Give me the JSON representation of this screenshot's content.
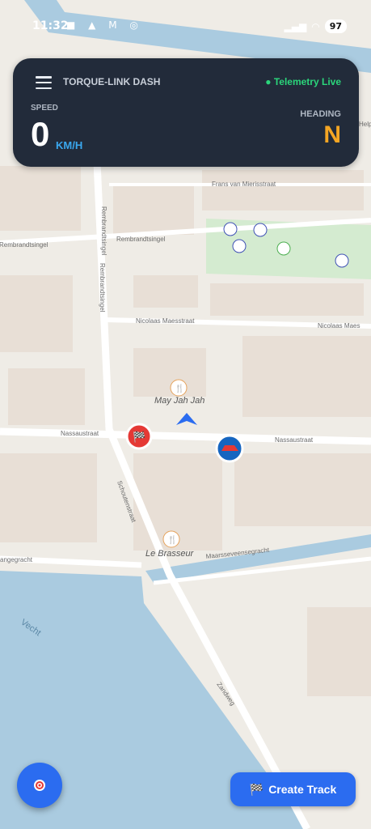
{
  "status_bar": {
    "time": "11:32",
    "battery": "97"
  },
  "dashboard": {
    "app_title": "TORQUE-LINK DASH",
    "telemetry_status": "Telemetry Live",
    "speed_label": "SPEED",
    "speed_value": "0",
    "speed_unit": "KM/H",
    "heading_label": "HEADING",
    "heading_value": "N"
  },
  "map": {
    "street_labels": [
      "Frans van Mierisstraat",
      "Rembrandtsingel",
      "Nicolaas Maesstraat",
      "Nicolaas Maes",
      "Nassaustraat",
      "Nassaustraat",
      "Schoutenstraat",
      "Maarsseveensegracht",
      "Zandweg",
      "Vecht",
      "angegracht",
      "Rembrandtsingel",
      "Rembrandtsingel",
      "Rembrandtsingel",
      "Help"
    ],
    "places": [
      {
        "name": "May Jah Jah",
        "icon": "restaurant-icon"
      },
      {
        "name": "Le Brasseur",
        "icon": "restaurant-icon"
      }
    ],
    "markers": [
      {
        "name": "checkered-flag-marker",
        "icon": "checkered-flag-icon",
        "color": "#e53935"
      },
      {
        "name": "car-marker",
        "icon": "car-icon",
        "color": "#1565c0"
      },
      {
        "name": "location-arrow",
        "icon": "navigation-arrow-icon",
        "color": "#2b6cf0"
      }
    ],
    "colors": {
      "water": "#aacbe0",
      "park": "#d4ebd0",
      "road": "#ffffff",
      "building": "#e8dfd6",
      "land": "#efece6"
    }
  },
  "fab": {
    "icon": "target-icon"
  },
  "create_track": {
    "label": "Create Track",
    "icon": "checkered-flag-icon"
  }
}
